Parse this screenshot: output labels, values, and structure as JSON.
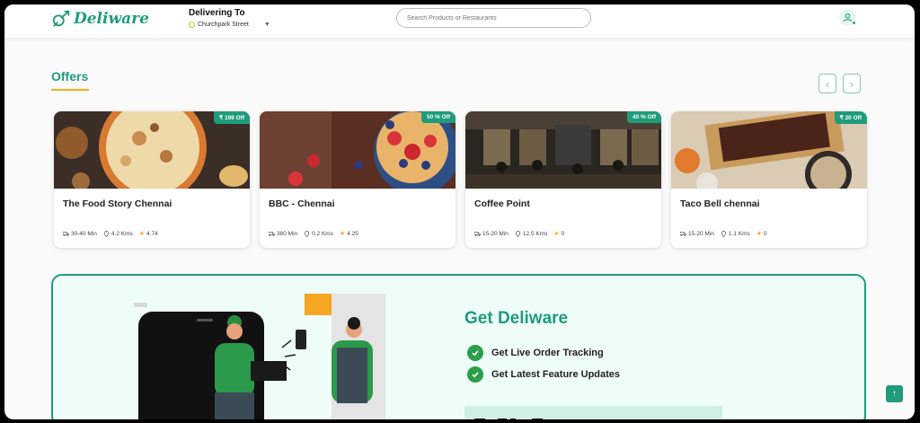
{
  "brand": {
    "name": "Deliware",
    "color": "#1e9c7c"
  },
  "header": {
    "delivering_to": "Delivering To",
    "location": "Churchpark Street",
    "search_placeholder": "Search Products or Restaurants"
  },
  "offers": {
    "title": "Offers",
    "cards": [
      {
        "name": "The Food Story Chennai",
        "badge": "₹ 199 Off",
        "time": "30-40 Min",
        "distance": "4.2 Kms",
        "rating": "4.74",
        "image": "pizza"
      },
      {
        "name": "BBC - Chennai",
        "badge": "50 % Off",
        "time": "380 Min",
        "distance": "0.2 Kms",
        "rating": "4.25",
        "image": "pancakes-berries"
      },
      {
        "name": "Coffee Point",
        "badge": "40 % Off",
        "time": "15-20 Min",
        "distance": "12.5 Kms",
        "rating": "0",
        "image": "restaurant-interior"
      },
      {
        "name": "Taco Bell chennai",
        "badge": "₹ 20 Off",
        "time": "15-20 Min",
        "distance": "1.1 Kms",
        "rating": "0",
        "image": "brownies"
      }
    ]
  },
  "promo": {
    "title": "Get Deliware",
    "features": [
      "Get Live Order Tracking",
      "Get Latest Feature Updates"
    ]
  },
  "colors": {
    "accent": "#1e9c7c",
    "highlight": "#f2b01e",
    "promo_bg": "#effdf9"
  },
  "icons": {
    "scroll_top": "arrow-up-icon",
    "user": "user-icon",
    "prev": "chevron-left-icon",
    "next": "chevron-right-icon"
  }
}
